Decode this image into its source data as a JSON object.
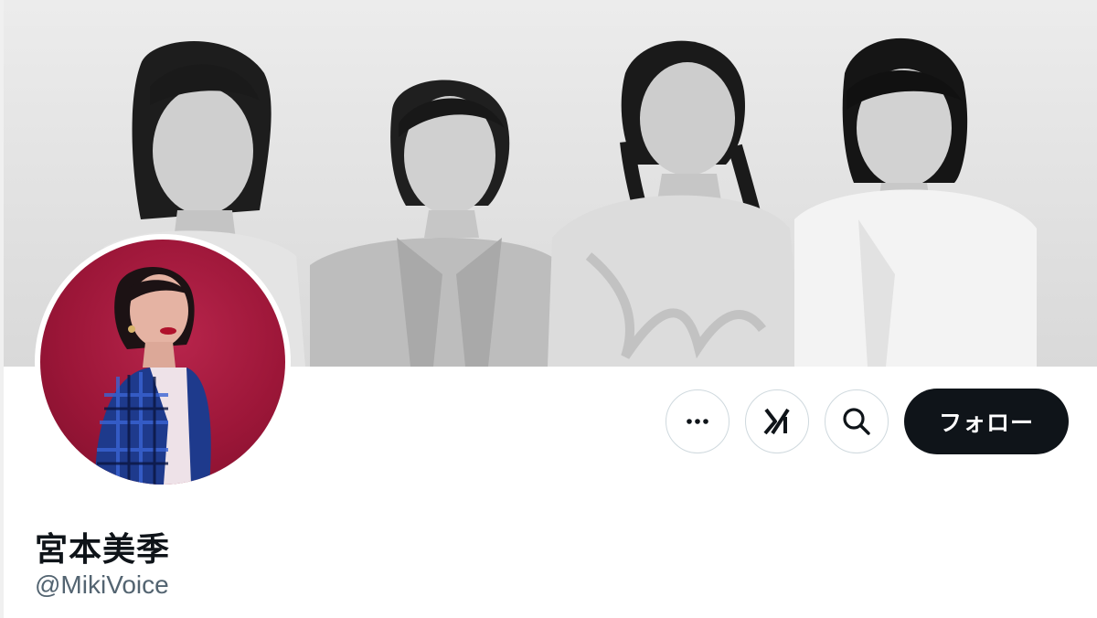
{
  "profile": {
    "display_name": "宮本美季",
    "handle": "@MikiVoice"
  },
  "banner": {
    "icon": "group-photo-banner"
  },
  "avatar": {
    "icon": "profile-photo"
  },
  "actions": {
    "more_icon": "more-horizontal-icon",
    "grok_icon": "grok-icon",
    "search_icon": "search-icon",
    "follow_label": "フォロー"
  },
  "colors": {
    "follow_bg": "#0f1419",
    "handle_gray": "#536471",
    "border": "#cfd9de",
    "avatar_bg": "#9c1638"
  }
}
